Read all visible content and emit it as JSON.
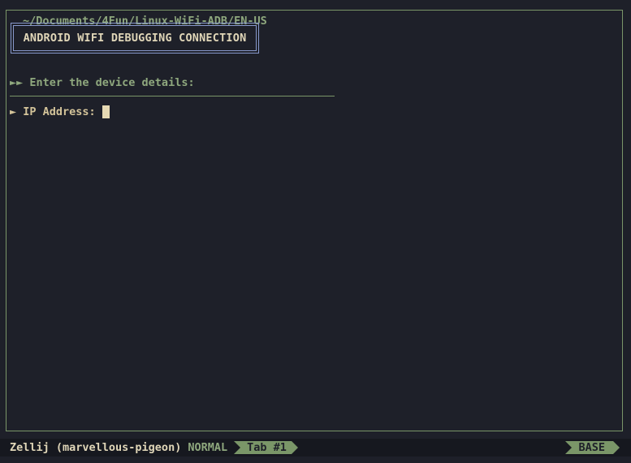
{
  "pane": {
    "title": "~/Documents/4Fun/Linux-WiFi-ADB/EN-US"
  },
  "banner": {
    "text": "ANDROID WIFI DEBUGGING CONNECTION"
  },
  "prompt": {
    "text": "►► Enter the device details:"
  },
  "ip_field": {
    "label": "► IP Address:",
    "value": ""
  },
  "statusbar": {
    "session": "Zellij (marvellous-pigeon)",
    "mode": "NORMAL",
    "tab": "Tab #1",
    "layout": "BASE"
  },
  "colors": {
    "background": "#1e2029",
    "accent_green": "#7a9668",
    "banner_border": "#8899cc",
    "text_tan": "#c8b896"
  }
}
